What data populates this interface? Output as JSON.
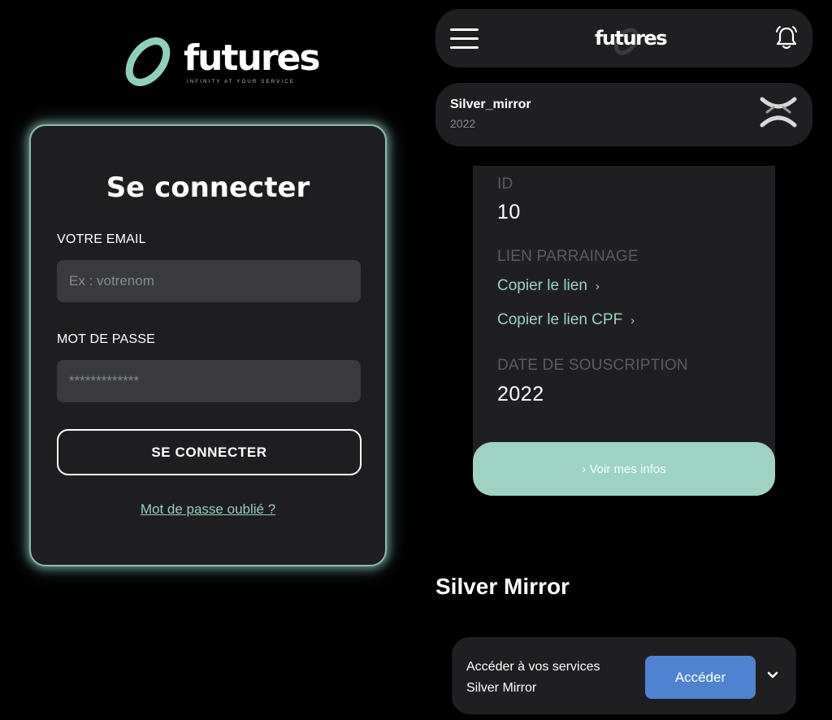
{
  "brand": {
    "name": "futures",
    "tagline": "INFINITY AT YOUR SERVICE"
  },
  "login": {
    "title": "Se connecter",
    "email_label": "VOTRE EMAIL",
    "email_placeholder": "Ex : votrenom",
    "password_label": "MOT DE PASSE",
    "password_placeholder": "*************",
    "submit_label": "SE CONNECTER",
    "forgot_label": "Mot de passe oublié ?"
  },
  "header": {
    "menu_icon": "hamburger-icon",
    "logo_text": "futures",
    "notification_icon": "bell-icon"
  },
  "subscription": {
    "name": "Silver_mirror",
    "year": "2022",
    "icon": "brand-x-icon"
  },
  "details": {
    "id_label": "ID",
    "id_value": "10",
    "referral_label": "LIEN PARRAINAGE",
    "copy_link": "Copier le lien",
    "copy_link_cpf": "Copier le lien CPF",
    "date_label": "DATE DE SOUSCRIPTION",
    "date_value": "2022",
    "more_info_button": "Voir mes infos"
  },
  "section": {
    "title": "Silver Mirror"
  },
  "service": {
    "line1": "Accéder à vos services",
    "line2": "Silver Mirror",
    "button": "Accéder",
    "expand_icon": "chevron-down-icon"
  },
  "colors": {
    "accent": "#9ed3c4",
    "card": "#1f1f21",
    "button_blue": "#4f83d1",
    "background": "#000000"
  }
}
